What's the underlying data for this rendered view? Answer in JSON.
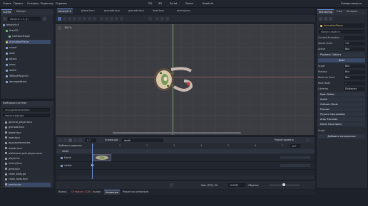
{
  "menu": {
    "items": [
      "Сцена",
      "Проект",
      "Отладка",
      "Редактор",
      "Справка"
    ],
    "workspaces": [
      "2D",
      "3D",
      "Script",
      "Game",
      "AssetLib"
    ],
    "right_label": "Совместимость"
  },
  "scene_dock": {
    "tabs": [
      "Сцена",
      "Импорт"
    ],
    "filter_placeholder": "Фильтр: t, n, g...",
    "nodes": [
      {
        "label": "bmonyt.r4",
        "color": "#8fa8d8"
      },
      {
        "label": "Area2D",
        "color": "#7fbf7f"
      },
      {
        "label": "CollisionShape",
        "color": "#7fbf7f"
      },
      {
        "label": "AnimationPlayer",
        "color": "#d8b86a"
      },
      {
        "label": "sound",
        "color": "#8fa8d8"
      },
      {
        "label": "walk",
        "color": "#8fa8d8"
      },
      {
        "label": "attack",
        "color": "#8fa8d8"
      },
      {
        "label": "jump",
        "color": "#8fa8d8"
      },
      {
        "label": "walk2",
        "color": "#8fa8d8"
      },
      {
        "label": "TsBlockPlayer22",
        "color": "#8fa8d8"
      },
      {
        "label": "damageattack",
        "color": "#8fa8d8"
      }
    ]
  },
  "fs_dock": {
    "title": "Файловая система",
    "path": "res://sprites/enemies/",
    "filter_placeholder": "Фильтр файлов",
    "files": [
      "general_player.tscn",
      "grenade.tscn",
      "blade.tscn",
      "laser.tscn",
      "bg.playerenemies",
      "weade.tscn",
      "platformer.pale.playerenem",
      "playerinv",
      "enemy.tscn",
      "grow.tscn",
      "chain_body.gd",
      "chain_body.tscn",
      "peerlocker"
    ]
  },
  "editor_tabs": [
    "bmonyt.r4",
    "player.tscn",
    "grenade.tscn",
    "grenade.tscn",
    "level.tscn",
    "enemy.tscn"
  ],
  "viewport": {
    "zoom_label": "100 %"
  },
  "animation": {
    "add_track_label": "Добавить дорожку",
    "animation_label": "Анимация:",
    "animation_name": "death",
    "edit_label": "Редактировать",
    "length_value": "0.7",
    "track_group": "death",
    "tracks": [
      {
        "label": "frame",
        "color": "#8fa8d8"
      },
      {
        "label": "visible",
        "color": "#8fa8d8"
      }
    ],
    "ruler": [
      "0",
      "1",
      "2",
      "3",
      "4",
      "5",
      "6",
      "7"
    ],
    "bezier_label": "Bezier",
    "fps_label": "Шаг (FPS): 30",
    "snap_value": "0.0333",
    "sort_label": "Обрезка",
    "zoom_label": "Масштаб"
  },
  "bottom_tabs": [
    "Вывод",
    "Отладчик (128)",
    "Аудио",
    "Анимация",
    "Редактор шейдеров"
  ],
  "inspector": {
    "tabs": [
      "Инспектор",
      "Узел",
      "История"
    ],
    "filter_placeholder": "Фильтр свойств",
    "node_name": "AnimationPlayer",
    "rows": [
      {
        "label": "Current Animation",
        "value": ""
      },
      {
        "label": "Speed Scale",
        "value": "1.0"
      },
      {
        "label": "Active",
        "value": "Вкл"
      }
    ],
    "playback_section": "Playback Options",
    "playback_rows": [
      {
        "label": "Script",
        "value": "Вкл"
      },
      {
        "label": "Process",
        "value": "Вкл"
      },
      {
        "label": "Reset on Save",
        "value": "Вкл"
      },
      {
        "label": "Root Node",
        "value": ".."
      },
      {
        "label": "Libraries",
        "value": "Dictionary"
      }
    ],
    "sections": [
      "Root Motion",
      "Audio",
      "Callback Mode",
      "Process",
      "Physics Interpolation",
      "Auto Translate",
      "Editor Description"
    ],
    "mode_label": "Node",
    "script_label": "Script",
    "add_metadata": "Добавить метаданные",
    "accent": "#6a8fd8"
  },
  "colors": {
    "background": "#1d2129",
    "panel": "#262b34",
    "accent": "#6a8fd8",
    "viewport": "#3b3d42"
  }
}
